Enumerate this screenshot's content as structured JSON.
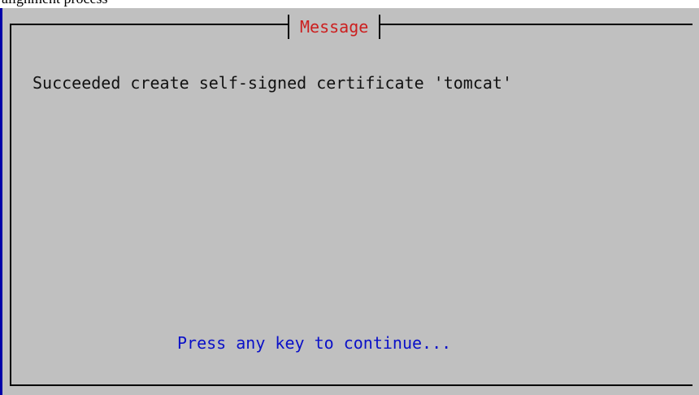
{
  "top_strip": {
    "text": "alignment process"
  },
  "dialog": {
    "title": "Message",
    "message": "Succeeded create self-signed certificate 'tomcat'",
    "prompt": "Press any key to continue..."
  },
  "colors": {
    "dialog_background": "#c0c0c0",
    "frame_border": "#000000",
    "title_text": "#cc1f1f",
    "message_text": "#111111",
    "prompt_text": "#0a10c8",
    "left_edge_accent": "#0000a8"
  }
}
